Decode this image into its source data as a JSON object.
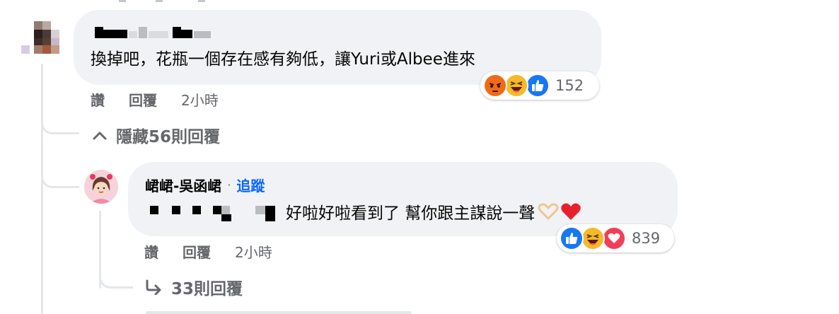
{
  "comment1": {
    "text": "換掉吧，花瓶一個存在感有夠低，讓Yuri或Albee進來",
    "reactions": {
      "icons": [
        "angry-icon",
        "haha-icon",
        "like-icon"
      ],
      "count": "152"
    },
    "actions": {
      "like": "讚",
      "reply": "回覆",
      "time": "2小時"
    },
    "hide_replies": "隱藏56則回覆"
  },
  "comment2": {
    "author": "峮峮-吳函峮",
    "separator": "·",
    "follow": "追蹤",
    "text": "好啦好啦看到了 幫你跟主謀說一聲",
    "emoji": [
      "heart-hands-emoji",
      "red-heart-emoji"
    ],
    "reactions": {
      "icons": [
        "like-icon",
        "haha-icon",
        "love-icon"
      ],
      "count": "839"
    },
    "actions": {
      "like": "讚",
      "reply": "回覆",
      "time": "2小時"
    },
    "more_replies": "33則回覆"
  },
  "colors": {
    "bubble": "#f0f2f5",
    "meta_grey": "#65676b",
    "link_blue": "#0866ff",
    "like_blue": "#1877f2",
    "love_red": "#f33e58",
    "haha_yellow": "#f7b928",
    "angry_orange": "#e9710f"
  }
}
